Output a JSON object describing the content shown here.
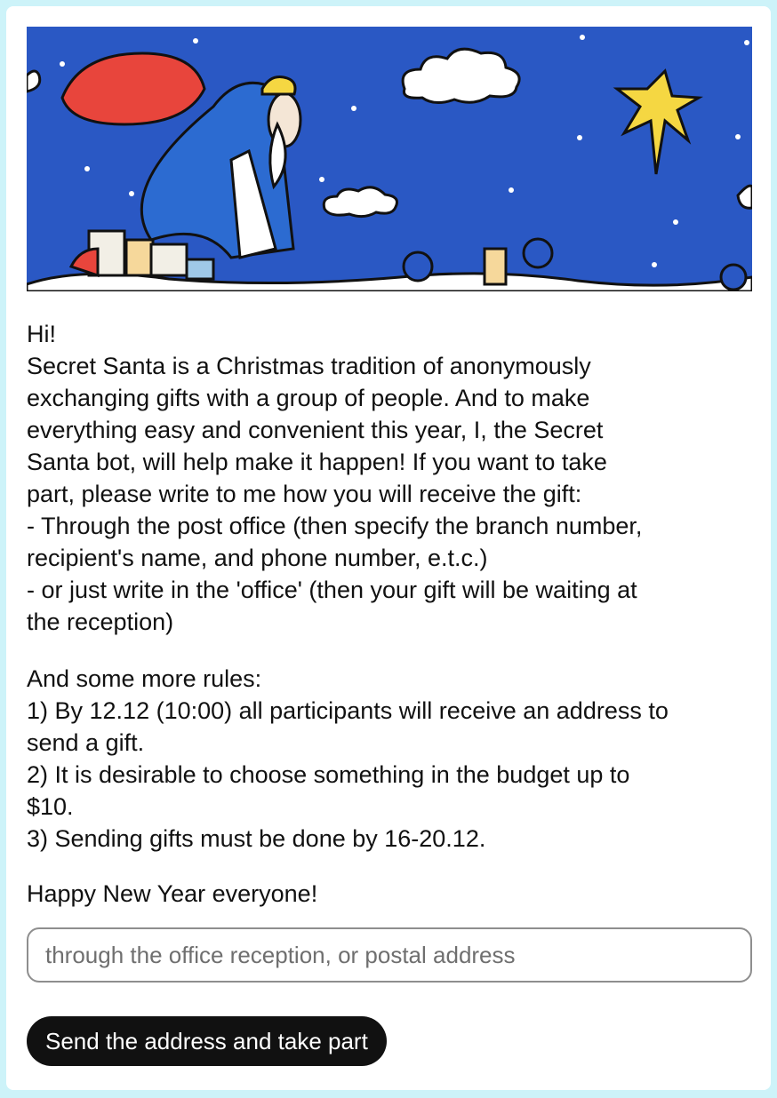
{
  "message": {
    "greeting": "Hi!",
    "intro_lines": [
      "Secret Santa is a Christmas tradition of anonymously",
      "exchanging gifts with a group of people. And to make",
      "everything easy and convenient this year, I, the Secret",
      "Santa bot, will help make it happen! If you want to take",
      "part, please write to me how you will receive the gift:",
      "- Through the post office (then specify the branch number,",
      "recipient's name, and phone number, e.t.c.)",
      "- or just write in the 'office' (then your gift will be waiting at",
      "the reception)"
    ],
    "rules_title": "And some more rules:",
    "rules_lines": [
      "1) By 12.12 (10:00) all participants will receive an address to",
      "send a gift.",
      "2) It is desirable to choose something in the budget up to",
      "$10.",
      "3) Sending gifts must be done by 16-20.12."
    ],
    "closing": "Happy New Year everyone!"
  },
  "form": {
    "address_placeholder": "through the office reception, or postal address",
    "address_value": "",
    "submit_label": "Send the address and take part"
  },
  "banner": {
    "illustration": "santa-walking-over-town-night-sky",
    "sky_color": "#2a58c4",
    "sack_color": "#e8453c",
    "star_color": "#f5d742"
  }
}
